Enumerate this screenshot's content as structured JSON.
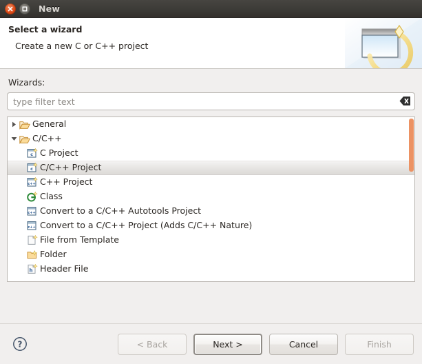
{
  "titlebar": {
    "title": "New",
    "close_icon": "close-icon",
    "maximize_icon": "maximize-icon"
  },
  "banner": {
    "title": "Select a wizard",
    "description": "Create a new C or C++ project",
    "icon": "new-wizard-banner-icon"
  },
  "wizards": {
    "label": "Wizards:",
    "filter": {
      "placeholder": "type filter text",
      "value": "",
      "clear_icon": "clear-icon"
    },
    "tree": [
      {
        "label": "General",
        "icon": "open-folder-icon",
        "level": 0,
        "twisty": "collapsed",
        "selected": false
      },
      {
        "label": "C/C++",
        "icon": "open-folder-icon",
        "level": 0,
        "twisty": "expanded",
        "selected": false
      },
      {
        "label": "C Project",
        "icon": "c-project-icon",
        "level": 1,
        "twisty": "none",
        "selected": false
      },
      {
        "label": "C/C++ Project",
        "icon": "c-project-icon",
        "level": 1,
        "twisty": "none",
        "selected": true
      },
      {
        "label": "C++ Project",
        "icon": "cpp-project-icon",
        "level": 1,
        "twisty": "none",
        "selected": false
      },
      {
        "label": "Class",
        "icon": "class-icon",
        "level": 1,
        "twisty": "none",
        "selected": false
      },
      {
        "label": "Convert to a C/C++ Autotools Project",
        "icon": "convert-project-icon",
        "level": 1,
        "twisty": "none",
        "selected": false
      },
      {
        "label": "Convert to a C/C++ Project (Adds C/C++ Nature)",
        "icon": "convert-project-icon",
        "level": 1,
        "twisty": "none",
        "selected": false
      },
      {
        "label": "File from Template",
        "icon": "file-template-icon",
        "level": 1,
        "twisty": "none",
        "selected": false
      },
      {
        "label": "Folder",
        "icon": "folder-icon",
        "level": 1,
        "twisty": "none",
        "selected": false
      },
      {
        "label": "Header File",
        "icon": "header-file-icon",
        "level": 1,
        "twisty": "none",
        "selected": false
      }
    ],
    "scrollbar": {
      "present": true,
      "color": "#ec9263"
    }
  },
  "footer": {
    "help_icon": "help-icon",
    "buttons": [
      {
        "label": "< Back",
        "name": "back-button",
        "disabled": true,
        "default": false
      },
      {
        "label": "Next >",
        "name": "next-button",
        "disabled": false,
        "default": true
      },
      {
        "label": "Cancel",
        "name": "cancel-button",
        "disabled": false,
        "default": false
      },
      {
        "label": "Finish",
        "name": "finish-button",
        "disabled": true,
        "default": false
      }
    ]
  },
  "colors": {
    "titlebar_bg": "#3b3a36",
    "close_button": "#dd4814",
    "accent_scrollbar": "#ec9263",
    "dialog_bg": "#f1efee",
    "text": "#2a2622"
  }
}
